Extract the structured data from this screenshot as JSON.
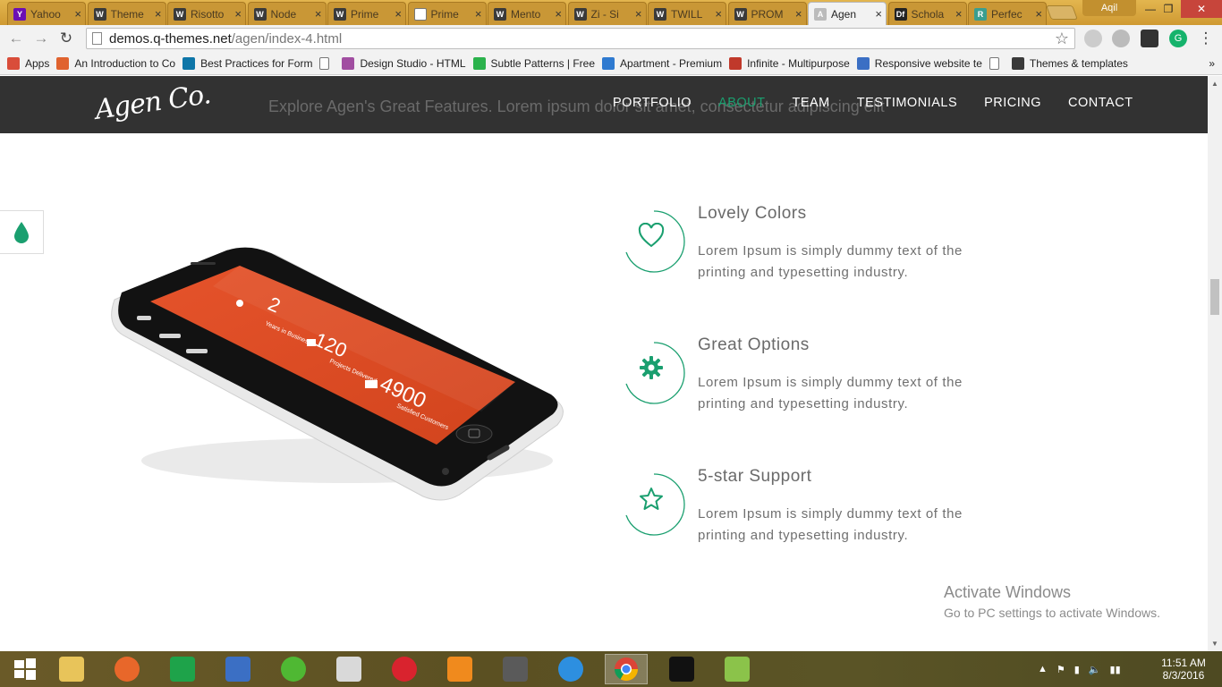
{
  "browser": {
    "tabs": [
      {
        "label": "Yahoo",
        "icon": "yahoo-icon",
        "color": "#6b0fb3",
        "glyph": "Y"
      },
      {
        "label": "Theme",
        "icon": "themeforest-icon",
        "color": "#3a3a3a",
        "glyph": "W"
      },
      {
        "label": "Risotto",
        "icon": "themeforest-icon",
        "color": "#3a3a3a",
        "glyph": "W"
      },
      {
        "label": "Node",
        "icon": "themeforest-icon",
        "color": "#3a3a3a",
        "glyph": "W"
      },
      {
        "label": "Prime",
        "icon": "themeforest-icon",
        "color": "#3a3a3a",
        "glyph": "W"
      },
      {
        "label": "Prime",
        "icon": "page-icon",
        "color": "#ffffff",
        "glyph": ""
      },
      {
        "label": "Mento",
        "icon": "themeforest-icon",
        "color": "#3a3a3a",
        "glyph": "W"
      },
      {
        "label": "Zi - Si",
        "icon": "themeforest-icon",
        "color": "#3a3a3a",
        "glyph": "W"
      },
      {
        "label": "TWILL",
        "icon": "themeforest-icon",
        "color": "#3a3a3a",
        "glyph": "W"
      },
      {
        "label": "PROM",
        "icon": "themeforest-icon",
        "color": "#3a3a3a",
        "glyph": "W"
      },
      {
        "label": "Agen",
        "icon": "agen-icon",
        "color": "#bbbbbb",
        "glyph": "A"
      },
      {
        "label": "Schola",
        "icon": "df-icon",
        "color": "#222222",
        "glyph": "Df"
      },
      {
        "label": "Perfec",
        "icon": "r-icon",
        "color": "#3b9e8f",
        "glyph": "R"
      }
    ],
    "user": "Aqil",
    "url_domain": "demos.q-themes.net",
    "url_path": "/agen/index-4.html",
    "bookmarks": [
      {
        "label": "Apps",
        "icon": "apps-grid-icon",
        "color": "#d94d3a"
      },
      {
        "label": "An Introduction to Co",
        "icon": "plus-icon",
        "color": "#e0632f"
      },
      {
        "label": "Best Practices for Form",
        "icon": "linkedin-icon",
        "color": "#0e76a8"
      },
      {
        "label": "",
        "icon": "page-icon",
        "color": "#ffffff"
      },
      {
        "label": "Design Studio - HTML",
        "icon": "d-icon",
        "color": "#a14ea1"
      },
      {
        "label": "Subtle Patterns | Free",
        "icon": "subtle-patterns-icon",
        "color": "#2bb24c"
      },
      {
        "label": "Apartment - Premium",
        "icon": "house-icon",
        "color": "#2f7ad0"
      },
      {
        "label": "Infinite - Multipurpose",
        "icon": "wp-icon",
        "color": "#c0392b"
      },
      {
        "label": "Responsive website te",
        "icon": "shield-icon",
        "color": "#3b6fc4"
      },
      {
        "label": "",
        "icon": "page-icon",
        "color": "#ffffff"
      },
      {
        "label": "Themes & templates",
        "icon": "themeforest-icon",
        "color": "#3a3a3a"
      }
    ]
  },
  "site": {
    "logo": "Agen Co.",
    "ghost_text": "Explore Agen's Great Features. Lorem ipsum dolor sit amet, consectetur adipiscing elit",
    "nav": [
      {
        "label": "PORTFOLIO",
        "active": false
      },
      {
        "label": "ABOUT",
        "active": true
      },
      {
        "label": "TEAM",
        "active": false
      },
      {
        "label": "TESTIMONIALS",
        "active": false
      },
      {
        "label": "PRICING",
        "active": false
      },
      {
        "label": "CONTACT",
        "active": false
      }
    ],
    "accent": "#1a9f6f",
    "phone_screen": {
      "stat1_value": "2",
      "stat1_label": "Years in Business",
      "stat2_value": "120",
      "stat2_label": "Projects Delivered",
      "stat3_value": "4900",
      "stat3_label": "Satisfied Customers"
    },
    "features": [
      {
        "title": "Lovely Colors",
        "text": "Lorem Ipsum is simply dummy text of the printing and typesetting industry.",
        "icon": "heart-icon"
      },
      {
        "title": "Great Options",
        "text": "Lorem Ipsum is simply dummy text of the printing and typesetting industry.",
        "icon": "gear-icon"
      },
      {
        "title": "5-star Support",
        "text": "Lorem Ipsum is simply dummy text of the printing and typesetting industry.",
        "icon": "star-icon"
      }
    ]
  },
  "os": {
    "activate_title": "Activate Windows",
    "activate_sub": "Go to PC settings to activate Windows.",
    "time": "11:51 AM",
    "date": "8/3/2016",
    "taskbar_apps": [
      "start-icon",
      "file-explorer-icon",
      "firefox-icon",
      "store-icon",
      "mail-icon",
      "frog-icon",
      "paint-icon",
      "opera-icon",
      "vlc-icon",
      "sublime-icon",
      "ie-icon",
      "chrome-icon",
      "e-app-icon",
      "bluestacks-icon"
    ]
  }
}
